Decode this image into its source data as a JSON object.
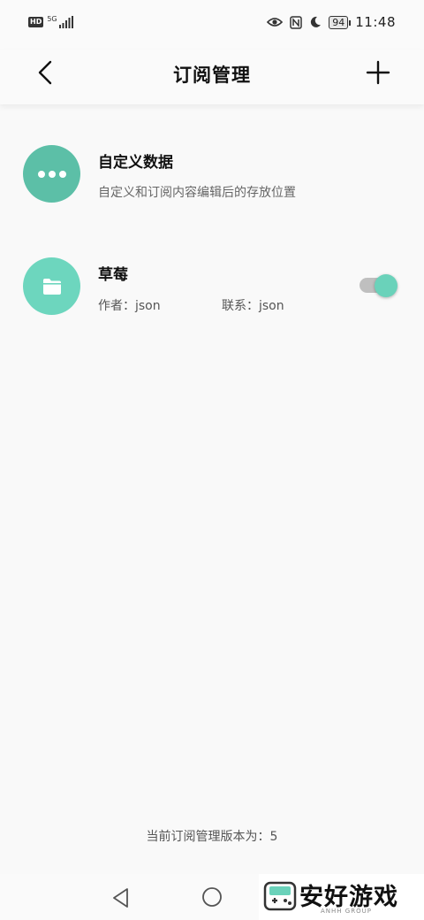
{
  "status_bar": {
    "hd_badge": "HD",
    "network": "5G",
    "battery": "94",
    "time": "11:48",
    "icons": [
      "signal-icon",
      "eye-icon",
      "nfc-icon",
      "moon-icon",
      "battery-icon"
    ]
  },
  "header": {
    "title": "订阅管理",
    "back_icon": "chevron-left-icon",
    "add_icon": "plus-icon"
  },
  "custom_item": {
    "title": "自定义数据",
    "description": "自定义和订阅内容编辑后的存放位置",
    "icon": "more-dots-icon",
    "avatar_color": "#5cbfa7"
  },
  "subscriptions": [
    {
      "title": "草莓",
      "author": "作者：json",
      "contact": "联系：json",
      "icon": "folder-icon",
      "avatar_color": "#6dd6be",
      "enabled": true
    }
  ],
  "footer": {
    "version_text": "当前订阅管理版本为：5"
  },
  "nav_bar": {
    "back_icon": "triangle-back-icon",
    "home_icon": "circle-home-icon"
  },
  "watermark": {
    "text": "安好游戏",
    "subtext": "ANHH GROUP"
  }
}
